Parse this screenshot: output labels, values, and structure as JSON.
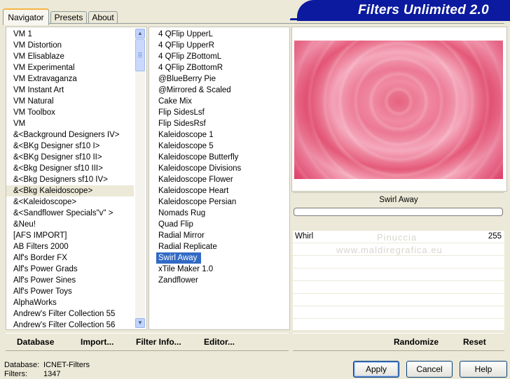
{
  "app": {
    "title": "Filters Unlimited 2.0"
  },
  "tabs": [
    {
      "label": "Navigator",
      "active": true
    },
    {
      "label": "Presets",
      "active": false
    },
    {
      "label": "About",
      "active": false
    }
  ],
  "categories": [
    "VM 1",
    "VM Distortion",
    "VM Elisablaze",
    "VM Experimental",
    "VM Extravaganza",
    "VM Instant Art",
    "VM Natural",
    "VM Toolbox",
    "VM",
    "&<Background Designers IV>",
    "&<BKg Designer sf10 I>",
    "&<BKg Designer sf10 II>",
    "&<Bkg Designer sf10 III>",
    "&<Bkg Designers sf10 IV>",
    "&<Bkg Kaleidoscope>",
    "&<Kaleidoscope>",
    "&<Sandflower Specials\"v\" >",
    "&Neu!",
    "[AFS IMPORT]",
    "AB Filters 2000",
    "Alf's Border FX",
    "Alf's Power Grads",
    "Alf's Power Sines",
    "Alf's Power Toys",
    "AlphaWorks",
    "Andrew's Filter Collection 55",
    "Andrew's Filter Collection 56"
  ],
  "selected_category": "&<Bkg Kaleidoscope>",
  "filters": [
    "4 QFlip UpperL",
    "4 QFlip UpperR",
    "4 QFlip ZBottomL",
    "4 QFlip ZBottomR",
    "@BlueBerry Pie",
    "@Mirrored & Scaled",
    "Cake Mix",
    "Flip SidesLsf",
    "Flip SidesRsf",
    "Kaleidoscope 1",
    "Kaleidoscope 5",
    "Kaleidoscope Butterfly",
    "Kaleidoscope Divisions",
    "Kaleidoscope Flower",
    "Kaleidoscope Heart",
    "Kaleidoscope Persian",
    "Nomads Rug",
    "Quad Flip",
    "Radial Mirror",
    "Radial Replicate",
    "Swirl Away",
    "xTile Maker 1.0",
    "Zandflower"
  ],
  "selected_filter": "Swirl Away",
  "preview": {
    "filter_name": "Swirl Away",
    "progress": 0
  },
  "parameters": [
    {
      "name": "Whirl",
      "value": "255"
    }
  ],
  "watermark": {
    "line1": "Pinuccia",
    "line2": "www.maldiregrafica.eu"
  },
  "toolbar": {
    "database": "Database",
    "import": "Import...",
    "filter_info": "Filter Info...",
    "editor": "Editor...",
    "randomize": "Randomize",
    "reset": "Reset"
  },
  "status": {
    "database_label": "Database:",
    "database_value": "ICNET-Filters",
    "filters_label": "Filters:",
    "filters_value": "1347"
  },
  "buttons": {
    "apply": "Apply",
    "cancel": "Cancel",
    "help": "Help"
  },
  "colors": {
    "banner": "#0b1a9e",
    "selection": "#316ac5",
    "tab_accent": "#f7b443"
  }
}
